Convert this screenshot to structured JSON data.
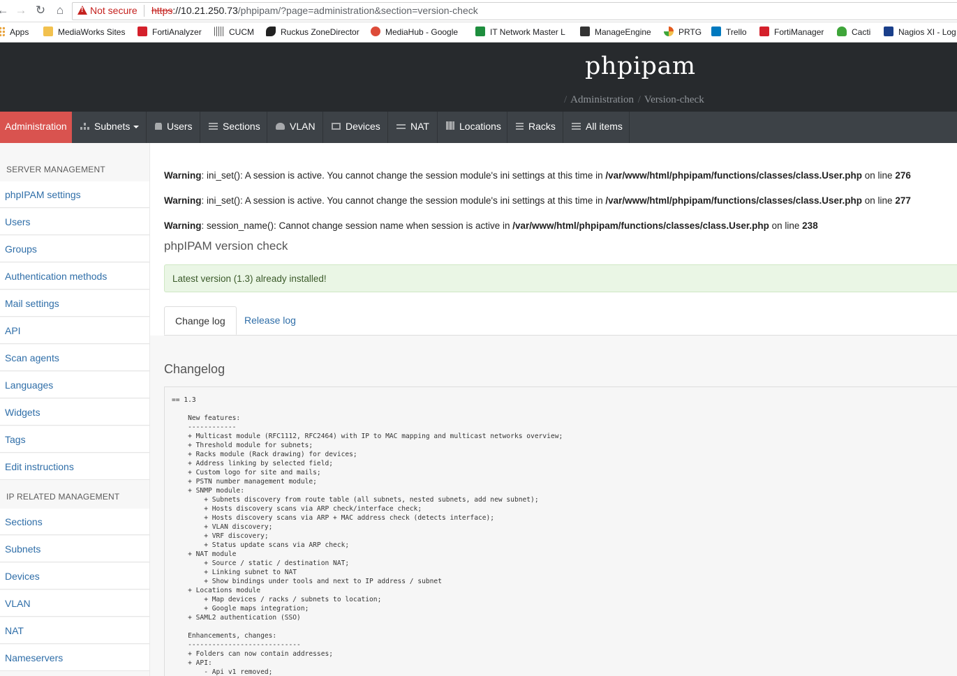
{
  "browser": {
    "not_secure": "Not secure",
    "url_scheme": "https",
    "url_host": "://10.21.250.73",
    "url_path": "/phpipam/?page=administration&section=version-check",
    "bookmarks": [
      {
        "label": "Apps",
        "icon": "apps-grid-icon",
        "color": "#e8a33d"
      },
      {
        "label": "MediaWorks Sites",
        "icon": "folder-icon",
        "color": "#f2c14e"
      },
      {
        "label": "FortiAnalyzer",
        "icon": "fortinet-icon",
        "color": "#d4202b"
      },
      {
        "label": "CUCM",
        "icon": "cisco-icon",
        "color": "#555555"
      },
      {
        "label": "Ruckus ZoneDirector",
        "icon": "ruckus-dog-icon",
        "color": "#222222"
      },
      {
        "label": "MediaHub - Google",
        "icon": "google-plus-icon",
        "color": "#dd4b39"
      },
      {
        "label": "IT Network Master L",
        "icon": "sheets-icon",
        "color": "#1e8e3e"
      },
      {
        "label": "ManageEngine",
        "icon": "manageengine-icon",
        "color": "#333333"
      },
      {
        "label": "PRTG",
        "icon": "prtg-gauge-icon",
        "color": "#e35b1e"
      },
      {
        "label": "Trello",
        "icon": "trello-icon",
        "color": "#0079bf"
      },
      {
        "label": "FortiManager",
        "icon": "fortinet-icon",
        "color": "#d4202b"
      },
      {
        "label": "Cacti",
        "icon": "cacti-icon",
        "color": "#3fa53a"
      },
      {
        "label": "Nagios XI - Log",
        "icon": "nagios-icon",
        "color": "#1a3f8a"
      }
    ]
  },
  "header": {
    "brand": "phpipam",
    "breadcrumb": [
      "Administration",
      "Version-check"
    ]
  },
  "menu": {
    "items": [
      {
        "label": "Administration",
        "icon": ""
      },
      {
        "label": "Subnets",
        "icon": "sitemap-icon"
      },
      {
        "label": "Users",
        "icon": "user-icon"
      },
      {
        "label": "Sections",
        "icon": "list-icon"
      },
      {
        "label": "VLAN",
        "icon": "cloud-icon"
      },
      {
        "label": "Devices",
        "icon": "desktop-icon"
      },
      {
        "label": "NAT",
        "icon": "exchange-icon"
      },
      {
        "label": "Locations",
        "icon": "map-icon"
      },
      {
        "label": "Racks",
        "icon": "bars-icon"
      },
      {
        "label": "All items",
        "icon": "list-icon"
      }
    ],
    "colors": {
      "active": "#d9534f",
      "bar": "#3d4247"
    }
  },
  "sidebar": {
    "server_heading": "SERVER MANAGEMENT",
    "server_items": [
      "phpIPAM settings",
      "Users",
      "Groups",
      "Authentication methods",
      "Mail settings",
      "API",
      "Scan agents",
      "Languages",
      "Widgets",
      "Tags",
      "Edit instructions"
    ],
    "ip_heading": "IP RELATED MANAGEMENT",
    "ip_items": [
      "Sections",
      "Subnets",
      "Devices",
      "VLAN",
      "NAT",
      "Nameservers"
    ]
  },
  "warnings": [
    {
      "label": "Warning",
      "text": ": ini_set(): A session is active. You cannot change the session module's ini settings at this time in ",
      "file": "/var/www/html/phpipam/functions/classes/class.User.php",
      "online": " on line ",
      "line": "276"
    },
    {
      "label": "Warning",
      "text": ": ini_set(): A session is active. You cannot change the session module's ini settings at this time in ",
      "file": "/var/www/html/phpipam/functions/classes/class.User.php",
      "online": " on line ",
      "line": "277"
    },
    {
      "label": "Warning",
      "text": ": session_name(): Cannot change session name when session is active in ",
      "file": "/var/www/html/phpipam/functions/classes/class.User.php",
      "online": " on line ",
      "line": "238"
    }
  ],
  "version_check": {
    "title": "phpIPAM version check",
    "status": "Latest version (1.3) already installed!"
  },
  "tabs": [
    "Change log",
    "Release log"
  ],
  "changelog": {
    "title": "Changelog",
    "text": "== 1.3\n\n    New features:\n    ------------\n    + Multicast module (RFC1112, RFC2464) with IP to MAC mapping and multicast networks overview;\n    + Threshold module for subnets;\n    + Racks module (Rack drawing) for devices;\n    + Address linking by selected field;\n    + Custom logo for site and mails;\n    + PSTN number management module;\n    + SNMP module:\n        + Subnets discovery from route table (all subnets, nested subnets, add new subnet);\n        + Hosts discovery scans via ARP check/interface check;\n        + Hosts discovery scans via ARP + MAC address check (detects interface);\n        + VLAN discovery;\n        + VRF discovery;\n        + Status update scans via ARP check;\n    + NAT module\n        + Source / static / destination NAT;\n        + Linking subnet to NAT\n        + Show bindings under tools and next to IP address / subnet\n    + Locations module\n        + Map devices / racks / subnets to location;\n        + Google maps integration;\n    + SAML2 authentication (SSO)\n\n    Enhancements, changes:\n    ----------------------------\n    + Folders can now contain addresses;\n    + API:\n        - Api v1 removed;"
  }
}
